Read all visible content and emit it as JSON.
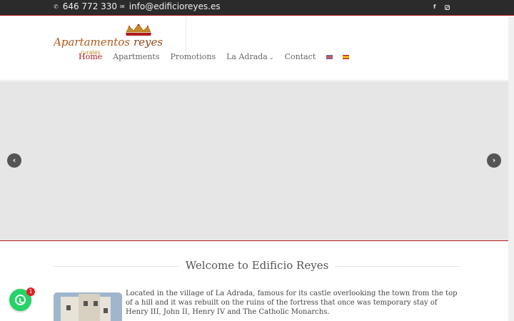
{
  "topbar": {
    "phone": "646 772 330",
    "email": "info@edificioreyes.es",
    "phone_icon": "phone-icon",
    "email_icon": "envelope-icon",
    "social": [
      "facebook-icon",
      "instagram-icon"
    ]
  },
  "logo": {
    "text_main": "Apartamentos",
    "text_brand": "reyes",
    "text_sub": "rurales"
  },
  "nav": {
    "items": [
      {
        "label": "Home",
        "active": true
      },
      {
        "label": "Apartments"
      },
      {
        "label": "Promotions"
      },
      {
        "label": "La Adrada",
        "has_dropdown": true
      },
      {
        "label": "Contact"
      }
    ],
    "languages": [
      "en-flag-icon",
      "es-flag-icon"
    ]
  },
  "slider": {
    "prev_icon": "chevron-left-icon",
    "next_icon": "chevron-right-icon"
  },
  "welcome": {
    "title": "Welcome to Edificio Reyes",
    "description": "Located in the village of La Adrada, famous for its castle overlooking the town from the top of a hill and it was rebuilt on the ruins of the fortress that once was temporary stay of Henry III, John II, Henry IV and The Catholic Monarchs."
  },
  "whatsapp": {
    "badge": "1"
  },
  "colors": {
    "accent": "#b01a1a",
    "topbar": "#2b2b2b",
    "whatsapp": "#25d366"
  }
}
